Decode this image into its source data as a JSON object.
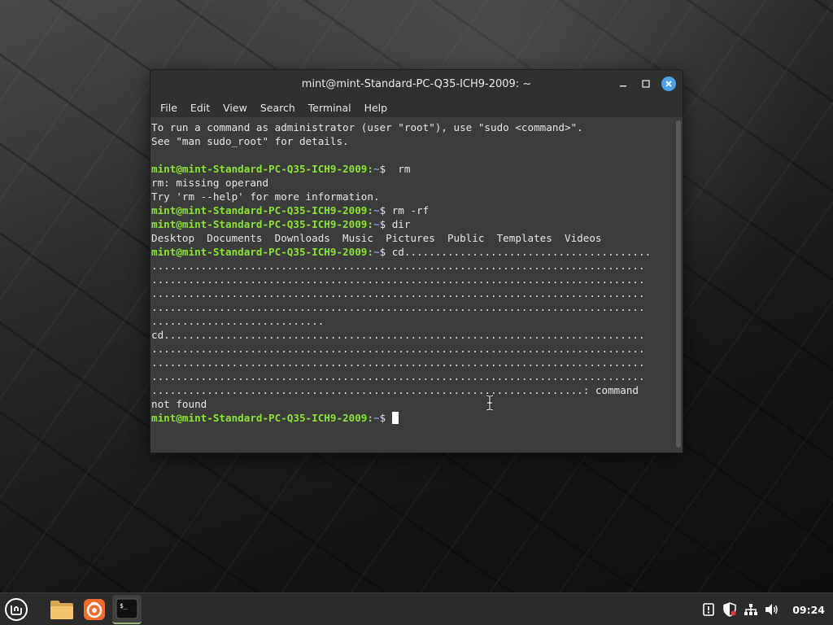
{
  "window": {
    "title": "mint@mint-Standard-PC-Q35-ICH9-2009: ~",
    "minimize_label": "–",
    "maximize_label": "□",
    "close_label": "✕"
  },
  "menu": {
    "items": [
      "File",
      "Edit",
      "View",
      "Search",
      "Terminal",
      "Help"
    ]
  },
  "terminal": {
    "prompt": "mint@mint-Standard-PC-Q35-ICH9-2009:",
    "lines": [
      {
        "type": "text",
        "text": "To run a command as administrator (user \"root\"), use \"sudo <command>\"."
      },
      {
        "type": "text",
        "text": "See \"man sudo_root\" for details."
      },
      {
        "type": "text",
        "text": ""
      },
      {
        "type": "prompt",
        "suffix": "~$  rm"
      },
      {
        "type": "text",
        "text": "rm: missing operand"
      },
      {
        "type": "text",
        "text": "Try 'rm --help' for more information."
      },
      {
        "type": "prompt",
        "suffix": "~$ rm -rf"
      },
      {
        "type": "prompt",
        "suffix": "~$ dir"
      },
      {
        "type": "text",
        "text": "Desktop  Documents  Downloads  Music  Pictures  Public  Templates  Videos"
      },
      {
        "type": "prompt",
        "suffix": "~$ cd........................................"
      },
      {
        "type": "text",
        "text": "................................................................................"
      },
      {
        "type": "text",
        "text": "................................................................................"
      },
      {
        "type": "text",
        "text": "................................................................................"
      },
      {
        "type": "text",
        "text": "................................................................................"
      },
      {
        "type": "text",
        "text": "............................"
      },
      {
        "type": "text",
        "text": "cd.............................................................................."
      },
      {
        "type": "text",
        "text": "................................................................................"
      },
      {
        "type": "text",
        "text": "................................................................................"
      },
      {
        "type": "text",
        "text": "................................................................................"
      },
      {
        "type": "text",
        "text": "......................................................................: command"
      },
      {
        "type": "text",
        "text": "not found"
      },
      {
        "type": "prompt_cursor",
        "suffix": "~$ "
      }
    ]
  },
  "taskbar": {
    "clock": "09:24",
    "launchers": [
      "menu-icon",
      "files-icon",
      "firefox-icon",
      "terminal-icon"
    ],
    "tray": [
      "update-manager-icon",
      "shield-icon",
      "network-icon",
      "volume-icon"
    ]
  }
}
